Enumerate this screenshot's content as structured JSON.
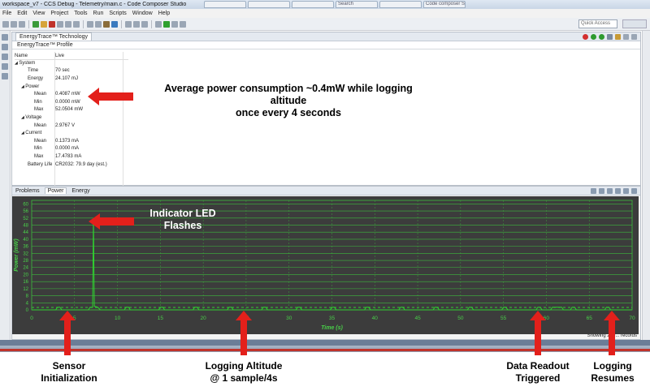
{
  "window": {
    "title": "workspace_v7 - CCS Debug - Telemetry/main.c - Code Composer Studio",
    "browser_tabs": [
      "",
      "",
      "",
      "Search",
      "",
      "Code composer Stu..."
    ]
  },
  "menu": [
    "File",
    "Edit",
    "View",
    "Project",
    "Tools",
    "Run",
    "Scripts",
    "Window",
    "Help"
  ],
  "quick_access": {
    "placeholder": "Quick Access"
  },
  "energytrace": {
    "tab_label": "EnergyTrace™ Technology",
    "subtab_label": "EnergyTrace™ Profile",
    "columns": [
      "Name",
      "Live"
    ],
    "rows": [
      {
        "name": "System",
        "value": "",
        "level": 0,
        "group": true
      },
      {
        "name": "Time",
        "value": "70 sec",
        "level": 1,
        "group": false
      },
      {
        "name": "Energy",
        "value": "24.107 mJ",
        "level": 1,
        "group": false
      },
      {
        "name": "Power",
        "value": "",
        "level": 1,
        "group": true
      },
      {
        "name": "Mean",
        "value": "0.4087 mW",
        "level": 2,
        "group": false
      },
      {
        "name": "Min",
        "value": "0.0000 mW",
        "level": 2,
        "group": false
      },
      {
        "name": "Max",
        "value": "52.0504 mW",
        "level": 2,
        "group": false
      },
      {
        "name": "Voltage",
        "value": "",
        "level": 1,
        "group": true
      },
      {
        "name": "Mean",
        "value": "2.9767 V",
        "level": 2,
        "group": false
      },
      {
        "name": "Current",
        "value": "",
        "level": 1,
        "group": true
      },
      {
        "name": "Mean",
        "value": "0.1373 mA",
        "level": 2,
        "group": false
      },
      {
        "name": "Min",
        "value": "0.0000 mA",
        "level": 2,
        "group": false
      },
      {
        "name": "Max",
        "value": "17.4783 mA",
        "level": 2,
        "group": false
      },
      {
        "name": "Battery Life",
        "value": "CR2032: 79.9 day (est.)",
        "level": 1,
        "group": false
      }
    ]
  },
  "bottom_tabs": [
    "Problems",
    "Power",
    "Energy"
  ],
  "records_label": "Showing 280... records",
  "annotations": {
    "power_note_line1": "Average power consumption ~0.4mW while logging altitude",
    "power_note_line2": "once every 4 seconds",
    "led_line1": "Indicator LED",
    "led_line2": "Flashes",
    "sensor_line1": "Sensor",
    "sensor_line2": "Initialization",
    "logging_line1": "Logging Altitude",
    "logging_line2": "@ 1 sample/4s",
    "readout_line1": "Data Readout",
    "readout_line2": "Triggered",
    "resume_line1": "Logging",
    "resume_line2": "Resumes"
  },
  "colors": {
    "chart_bg": "#3c3c3c",
    "chart_grid": "#3db83d",
    "chart_line": "#2fd12f",
    "arrow": "#e3201b"
  },
  "chart_data": {
    "type": "line",
    "title": "",
    "xlabel": "Time (s)",
    "ylabel": "Power (mW)",
    "xlim": [
      0,
      70
    ],
    "ylim": [
      0,
      62
    ],
    "xticks": [
      0,
      5,
      10,
      15,
      20,
      25,
      30,
      35,
      40,
      45,
      50,
      55,
      60,
      65,
      70
    ],
    "yticks": [
      0,
      4,
      8,
      12,
      16,
      20,
      24,
      28,
      32,
      36,
      40,
      44,
      48,
      52,
      56,
      60
    ],
    "grid": true,
    "series": [
      {
        "name": "",
        "points": [
          [
            0,
            0
          ],
          [
            2.8,
            0
          ],
          [
            3,
            1.5
          ],
          [
            3.3,
            1.5
          ],
          [
            3.5,
            0
          ],
          [
            6.6,
            0
          ],
          [
            6.8,
            1.5
          ],
          [
            7.1,
            1.5
          ],
          [
            7.2,
            52
          ],
          [
            7.3,
            2
          ],
          [
            7.7,
            1.5
          ],
          [
            8,
            0
          ],
          [
            10.8,
            0
          ],
          [
            11,
            1.5
          ],
          [
            11.3,
            1.5
          ],
          [
            11.5,
            0
          ],
          [
            14.8,
            0
          ],
          [
            15,
            1.5
          ],
          [
            15.3,
            1.5
          ],
          [
            15.5,
            0
          ],
          [
            18.8,
            0
          ],
          [
            19,
            1.5
          ],
          [
            19.3,
            1.5
          ],
          [
            19.5,
            0
          ],
          [
            22.8,
            0
          ],
          [
            23,
            1.5
          ],
          [
            23.3,
            1.5
          ],
          [
            23.5,
            0
          ],
          [
            26.8,
            0
          ],
          [
            27,
            1.5
          ],
          [
            27.3,
            1.5
          ],
          [
            27.5,
            0
          ],
          [
            30.8,
            0
          ],
          [
            31,
            1.5
          ],
          [
            31.3,
            1.5
          ],
          [
            31.5,
            0
          ],
          [
            34.8,
            0
          ],
          [
            35,
            1.5
          ],
          [
            35.3,
            1.5
          ],
          [
            35.5,
            0
          ],
          [
            38.8,
            0
          ],
          [
            39,
            1.5
          ],
          [
            39.3,
            1.5
          ],
          [
            39.5,
            0
          ],
          [
            42.8,
            0
          ],
          [
            43,
            1.5
          ],
          [
            43.3,
            1.5
          ],
          [
            43.5,
            0
          ],
          [
            46.8,
            0
          ],
          [
            47,
            1.5
          ],
          [
            47.3,
            1.5
          ],
          [
            47.5,
            0
          ],
          [
            50.8,
            0
          ],
          [
            51,
            1.5
          ],
          [
            51.3,
            1.5
          ],
          [
            51.5,
            0
          ],
          [
            54.8,
            0
          ],
          [
            55,
            1.5
          ],
          [
            55.3,
            1.5
          ],
          [
            55.5,
            0
          ],
          [
            58.8,
            0
          ],
          [
            59,
            1.5
          ],
          [
            59.3,
            1.5
          ],
          [
            59.5,
            0
          ],
          [
            60.5,
            0
          ],
          [
            60.7,
            1.5
          ],
          [
            61.8,
            1.5
          ],
          [
            62,
            0
          ],
          [
            62.8,
            0
          ],
          [
            63,
            1.5
          ],
          [
            63.3,
            1.5
          ],
          [
            63.5,
            0
          ],
          [
            66.8,
            0
          ],
          [
            67,
            1.5
          ],
          [
            67.3,
            1.5
          ],
          [
            67.5,
            0
          ],
          [
            70,
            0
          ]
        ]
      }
    ]
  }
}
